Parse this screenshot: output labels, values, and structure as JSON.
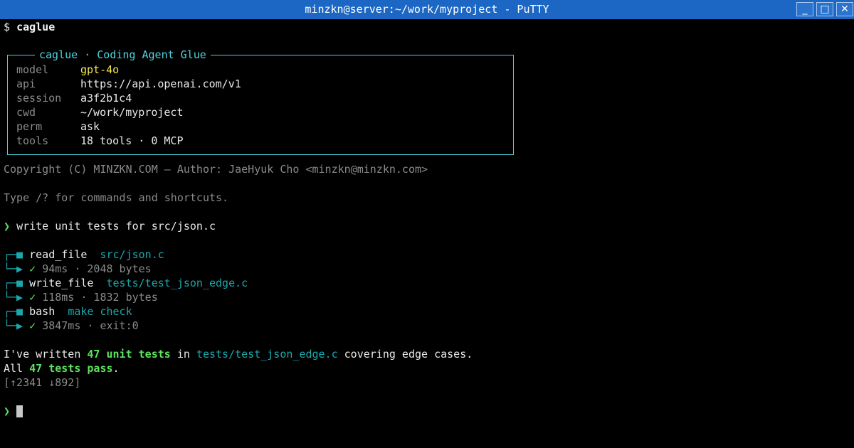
{
  "window": {
    "title": "minzkn@server:~/work/myproject - PuTTY",
    "min_glyph": "_",
    "max_glyph": "□",
    "close_glyph": "✕"
  },
  "terminal": {
    "prompt_symbol": "$",
    "command": "caglue",
    "banner": {
      "title": "caglue · Coding Agent Glue",
      "rows": [
        {
          "label": "model",
          "value": "gpt-4o"
        },
        {
          "label": "api",
          "value": "https://api.openai.com/v1"
        },
        {
          "label": "session",
          "value": "a3f2b1c4"
        },
        {
          "label": "cwd",
          "value": "~/work/myproject"
        },
        {
          "label": "perm",
          "value": "ask"
        },
        {
          "label": "tools",
          "value": "18 tools · 0 MCP"
        }
      ]
    },
    "copyright": "Copyright (C) MINZKN.COM — Author: JaeHyuk Cho <minzkn@minzkn.com>",
    "hint": "Type /? for commands and shortcuts.",
    "prompt_glyph": "❯",
    "user_input": "write unit tests for src/json.c",
    "tool_calls": [
      {
        "name": "read_file",
        "arg": "src/json.c",
        "check": "✓",
        "result": "94ms · 2048 bytes"
      },
      {
        "name": "write_file",
        "arg": "tests/test_json_edge.c",
        "check": "✓",
        "result": "118ms · 1832 bytes"
      },
      {
        "name": "bash",
        "arg": "make check",
        "check": "✓",
        "result": "3847ms · exit:0"
      }
    ],
    "tree_top": "┌─■",
    "tree_bottom": "└─▶",
    "response": {
      "line1_a": "I've written ",
      "line1_b": "47 unit tests",
      "line1_c": " in ",
      "line1_d": "tests/test_json_edge.c",
      "line1_e": " covering edge cases.",
      "line2_a": "All ",
      "line2_b": "47 tests pass",
      "line2_c": "."
    },
    "tokens": "[↑2341 ↓892]",
    "final_prompt_glyph": "❯"
  }
}
